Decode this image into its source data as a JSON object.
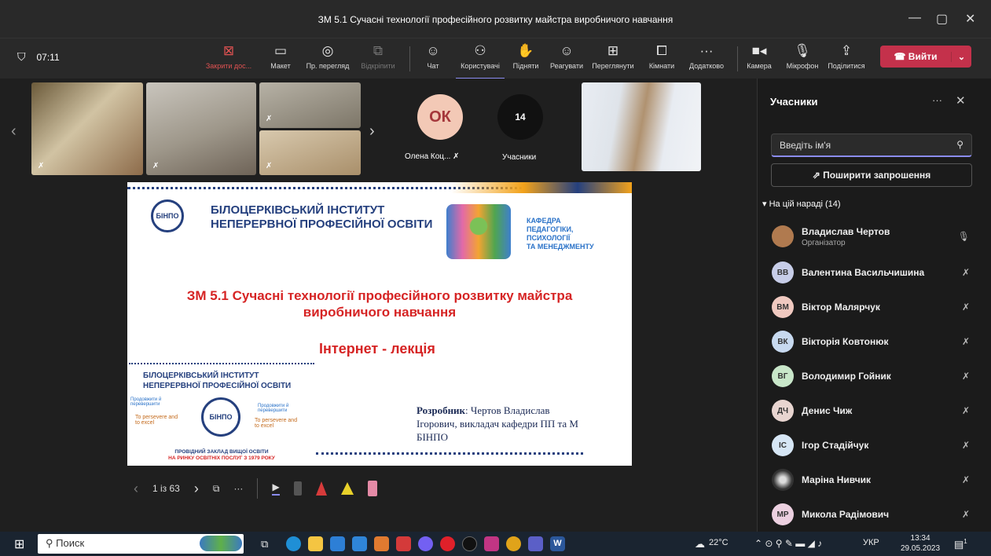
{
  "window": {
    "title": "ЗМ 5.1 Сучасні технології професійного розвитку майстра виробничого навчання",
    "minimize_icon": "—",
    "maximize_icon": "▢",
    "close_icon": "✕"
  },
  "toolbar": {
    "timer": "07:11",
    "close_share": "Закрити дос...",
    "layout": "Макет",
    "preview": "Пр. перегляд",
    "unpin": "Відкріпити",
    "chat": "Чат",
    "people": "Користувачі",
    "raise": "Підняти",
    "react": "Реагувати",
    "view": "Переглянути",
    "rooms": "Кімнати",
    "more": "Додатково",
    "camera": "Камера",
    "mic": "Мікрофон",
    "share": "Поділитися",
    "leave": "Вийти"
  },
  "gallery": {
    "avatar_initials": "ОК",
    "avatar_name": "Олена Коц...",
    "participants_count": "14",
    "participants_label": "Учасники"
  },
  "slide": {
    "institute_line1": "БІЛОЦЕРКІВСЬКИЙ ІНСТИТУТ",
    "institute_line2": "НЕПЕРЕРВНОЇ ПРОФЕСІЙНОЇ ОСВІТИ",
    "dept_line1": "КАФЕДРА",
    "dept_line2": "ПЕДАГОГІКИ,",
    "dept_line3": "ПСИХОЛОГІЇ",
    "dept_line4": "ТА МЕНЕДЖМЕНТУ",
    "title_line1": "ЗМ 5.1 Сучасні технології професійного розвитку майстра",
    "title_line2": "виробничого навчання",
    "subtitle": "Інтернет - лекція",
    "small_inst1": "БІЛОЦЕРКІВСЬКИЙ ІНСТИТУТ",
    "small_inst2": "НЕПЕРЕРВНОЇ ПРОФЕСІЙНОЇ ОСВІТИ",
    "motto_ua_left": "Продовжити й перевершити",
    "motto_en_left": "To persevere and to excel",
    "motto_ua_right": "Продовжити й перевершити",
    "motto_en_right": "To persevere and to excel",
    "leading1": "ПРОВІДНИЙ ЗАКЛАД ВИЩОЇ ОСВІТИ",
    "leading2": "НА РИНКУ ОСВІТНІХ ПОСЛУГ З 1979 РОКУ",
    "author_label": "Розробник",
    "author_line1": ": Чертов Владислав",
    "author_line2": "Ігорович, викладач кафедри ПП та М",
    "author_line3": "БІНПО",
    "page": "1 із 63"
  },
  "panel": {
    "title": "Учасники",
    "search_placeholder": "Введіть ім'я",
    "invite": "Поширити запрошення",
    "group": "На цій нараді (14)",
    "people": [
      {
        "initials": "",
        "name": "Владислав Чертов",
        "role": "Організатор",
        "color": "#b07a4f",
        "mic": "on"
      },
      {
        "initials": "ВВ",
        "name": "Валентина Васильчишина",
        "role": "",
        "color": "#c7cde8",
        "mic": "off"
      },
      {
        "initials": "ВМ",
        "name": "Віктор Малярчук",
        "role": "",
        "color": "#f0c9c0",
        "mic": "off"
      },
      {
        "initials": "ВК",
        "name": "Вікторія Ковтонюк",
        "role": "",
        "color": "#c7d9ef",
        "mic": "off"
      },
      {
        "initials": "ВГ",
        "name": "Володимир Гойник",
        "role": "",
        "color": "#c8e6c9",
        "mic": "off"
      },
      {
        "initials": "ДЧ",
        "name": "Денис Чиж",
        "role": "",
        "color": "#e8d5d0",
        "mic": "off"
      },
      {
        "initials": "ІС",
        "name": "Ігор Стадійчук",
        "role": "",
        "color": "#d6e6f5",
        "mic": "off"
      },
      {
        "initials": "",
        "name": "Маріна Нивчик",
        "role": "",
        "color": "#444444",
        "mic": "off"
      },
      {
        "initials": "МР",
        "name": "Микола Радімович",
        "role": "",
        "color": "#ecd0e0",
        "mic": "off"
      }
    ]
  },
  "taskbar": {
    "search": "Поиск",
    "temperature": "22°C",
    "lang": "УКР",
    "time": "13:34",
    "date": "29.05.2023",
    "notif_badge": "1"
  }
}
